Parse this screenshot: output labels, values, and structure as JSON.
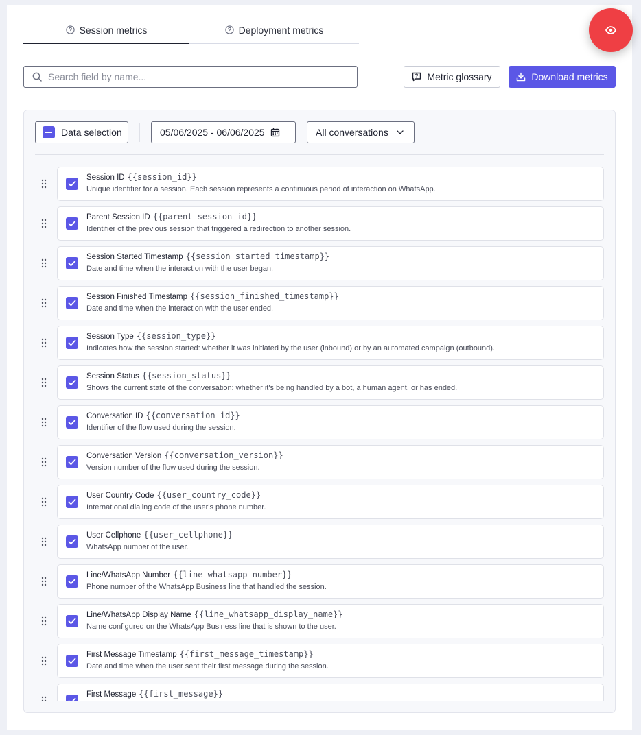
{
  "tabs": [
    {
      "label": "Session metrics",
      "active": true
    },
    {
      "label": "Deployment metrics",
      "active": false
    }
  ],
  "search": {
    "placeholder": "Search field by name..."
  },
  "toolbar": {
    "glossary_label": "Metric glossary",
    "download_label": "Download metrics"
  },
  "filters": {
    "selection_label": "Data selection",
    "date_range": "05/06/2025 - 06/06/2025",
    "conversation_filter": "All conversations"
  },
  "colors": {
    "accent": "#5b57e6",
    "fab": "#ef3f44"
  },
  "fields": [
    {
      "name": "Session ID",
      "var": "{{session_id}}",
      "desc": "Unique identifier for a session. Each session represents a continuous period of interaction on WhatsApp.",
      "checked": true
    },
    {
      "name": "Parent Session ID",
      "var": "{{parent_session_id}}",
      "desc": "Identifier of the previous session that triggered a redirection to another session.",
      "checked": true
    },
    {
      "name": "Session Started Timestamp",
      "var": "{{session_started_timestamp}}",
      "desc": "Date and time when the interaction with the user began.",
      "checked": true
    },
    {
      "name": "Session Finished Timestamp",
      "var": "{{session_finished_timestamp}}",
      "desc": "Date and time when the interaction with the user ended.",
      "checked": true
    },
    {
      "name": "Session Type",
      "var": "{{session_type}}",
      "desc": "Indicates how the session started: whether it was initiated by the user (inbound) or by an automated campaign (outbound).",
      "checked": true
    },
    {
      "name": "Session Status",
      "var": "{{session_status}}",
      "desc": "Shows the current state of the conversation: whether it's being handled by a bot, a human agent, or has ended.",
      "checked": true
    },
    {
      "name": "Conversation ID",
      "var": "{{conversation_id}}",
      "desc": "Identifier of the flow used during the session.",
      "checked": true
    },
    {
      "name": "Conversation Version",
      "var": "{{conversation_version}}",
      "desc": "Version number of the flow used during the session.",
      "checked": true
    },
    {
      "name": "User Country Code",
      "var": "{{user_country_code}}",
      "desc": "International dialing code of the user's phone number.",
      "checked": true
    },
    {
      "name": "User Cellphone",
      "var": "{{user_cellphone}}",
      "desc": "WhatsApp number of the user.",
      "checked": true
    },
    {
      "name": "Line/WhatsApp Number",
      "var": "{{line_whatsapp_number}}",
      "desc": "Phone number of the WhatsApp Business line that handled the session.",
      "checked": true
    },
    {
      "name": "Line/WhatsApp Display Name",
      "var": "{{line_whatsapp_display_name}}",
      "desc": "Name configured on the WhatsApp Business line that is shown to the user.",
      "checked": true
    },
    {
      "name": "First Message Timestamp",
      "var": "{{first_message_timestamp}}",
      "desc": "Date and time when the user sent their first message during the session.",
      "checked": true
    },
    {
      "name": "First Message",
      "var": "{{first_message}}",
      "desc": "",
      "checked": true
    }
  ]
}
